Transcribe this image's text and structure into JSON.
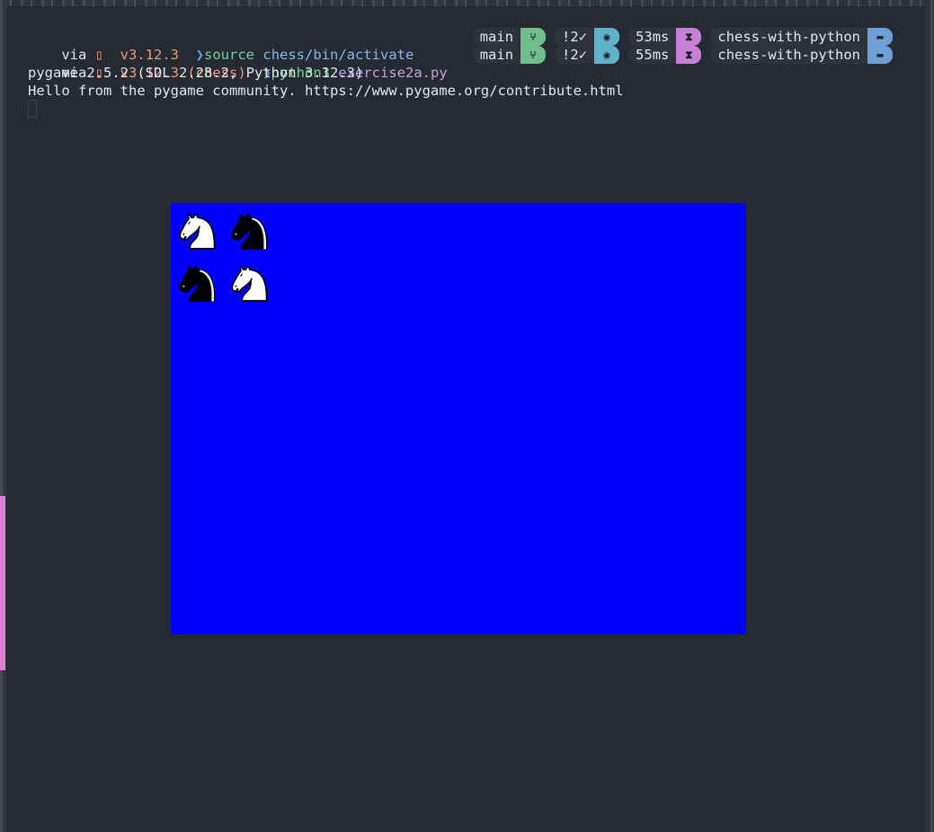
{
  "terminal": {
    "line1": {
      "via": "via ",
      "lang_icon": "python-icon",
      "version": "v3.12.3",
      "env": "",
      "cmd": "source",
      "arg": "chess/bin/activate"
    },
    "line2": {
      "via": "via ",
      "lang_icon": "python-icon",
      "version": "v3.12.3 (chess)",
      "cmd": "python3",
      "arg": "exercise2a.py"
    },
    "status1": {
      "branch": "main",
      "git_status": "!2✓",
      "duration": "53ms",
      "dir": "chess-with-python"
    },
    "status2": {
      "branch": "main",
      "git_status": "!2✓",
      "duration": "55ms",
      "dir": "chess-with-python"
    },
    "output1": "pygame 2.5.2 (SDL 2.28.2, Python 3.12.3)",
    "output2": "Hello from the pygame community. https://www.pygame.org/contribute.html"
  },
  "pygame_window": {
    "background_color": "#0000ff",
    "pieces": [
      {
        "type": "knight",
        "color": "white",
        "row": 0,
        "col": 0
      },
      {
        "type": "knight",
        "color": "black",
        "row": 0,
        "col": 1
      },
      {
        "type": "knight",
        "color": "black",
        "row": 1,
        "col": 0
      },
      {
        "type": "knight",
        "color": "white",
        "row": 1,
        "col": 1
      }
    ]
  },
  "colors": {
    "terminal_bg": "#262a33",
    "version": "#e79a7c",
    "command": "#6fd39c",
    "path": "#82b8ec"
  }
}
